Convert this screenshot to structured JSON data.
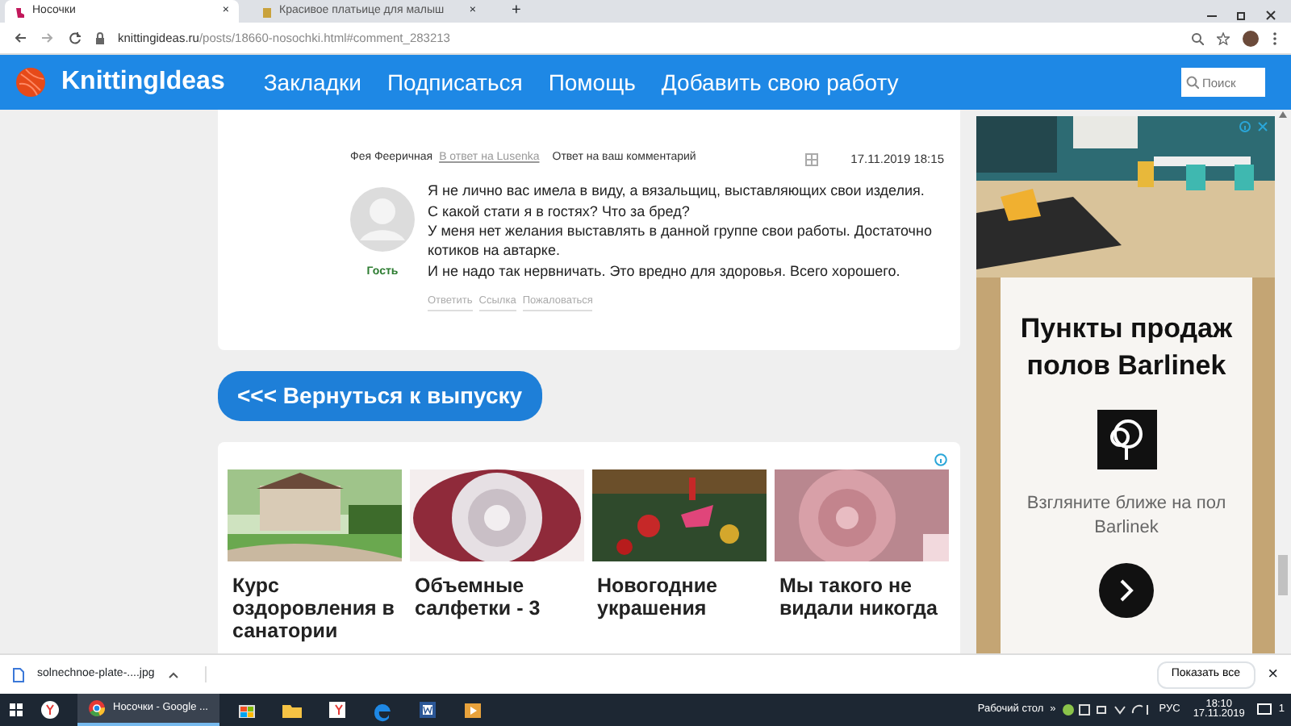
{
  "browser": {
    "tabs": [
      {
        "title": "Носочки",
        "selected": true,
        "close": "×"
      },
      {
        "title": "Красивое платьице для малыш",
        "selected": false,
        "close": "×"
      }
    ],
    "new_tab": "+",
    "url_host": "knittingideas.ru",
    "url_path": "/posts/18660-nosochki.html#comment_283213"
  },
  "site_nav": {
    "logo": "KnittingIdeas",
    "links": [
      "Закладки",
      "Подписаться",
      "Помощь",
      "Добавить свою работу"
    ],
    "search_placeholder": "Поиск"
  },
  "comment": {
    "author": "Фея Фееричная",
    "reply_link": "В ответ на Lusenka",
    "note": "Ответ на ваш комментарий",
    "date": "17.11.2019 18:15",
    "role": "Гость",
    "paragraphs": [
      "Я не лично вас имела в виду, а вязальщиц, выставляющих свои изделия.",
      "С какой стати я в гостях? Что за бред?",
      "У меня нет желания выставлять в данной группе свои работы. Достаточно котиков на автарке.",
      "И не надо так нервничать. Это вредно для здоровья. Всего хорошего."
    ],
    "actions": [
      "Ответить",
      "Ссылка",
      "Пожаловаться"
    ]
  },
  "back_button": "<<< Вернуться к выпуску",
  "recommendations": [
    {
      "title": "Курс оздоровления в санатории"
    },
    {
      "title": "Объемные салфетки - 3"
    },
    {
      "title": "Новогодние украшения"
    },
    {
      "title": "Мы такого не видали никогда"
    }
  ],
  "ad": {
    "title": "Пункты продаж полов Barlinek",
    "text": "Взгляните ближе на пол Barlinek"
  },
  "download_bar": {
    "file": "solnechnoe-plate-....jpg",
    "show_all": "Показать все",
    "close": "×"
  },
  "taskbar": {
    "apps": [
      {
        "kind": "yandex",
        "active": false
      },
      {
        "kind": "chrome",
        "label": "Носочки - Google ...",
        "active": true
      },
      {
        "kind": "store",
        "active": false
      },
      {
        "kind": "folder",
        "active": false
      },
      {
        "kind": "yabrowser",
        "active": false
      },
      {
        "kind": "edge",
        "active": false
      },
      {
        "kind": "word",
        "active": false
      },
      {
        "kind": "media",
        "active": false
      }
    ],
    "desktop": "Рабочий стол",
    "chevron": "»",
    "lang": "РУС",
    "time": "18:10",
    "date": "17.11.2019",
    "notifications": "1"
  }
}
